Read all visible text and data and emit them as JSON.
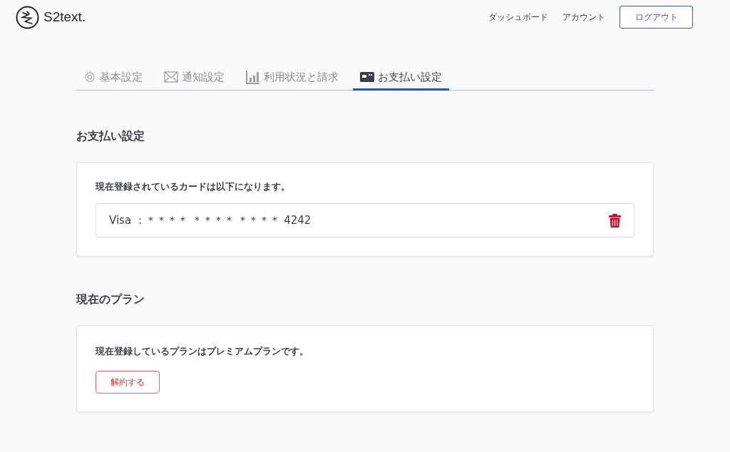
{
  "header": {
    "logo": "S2text.",
    "nav": [
      "ダッシュボード",
      "アカウント"
    ],
    "logout": "ログアウト"
  },
  "tabs": [
    {
      "kind": "gear",
      "label": "基本設定",
      "selected": false
    },
    {
      "kind": "mail",
      "label": "通知設定",
      "selected": false
    },
    {
      "kind": "chart",
      "label": "利用状況と請求",
      "selected": false
    },
    {
      "kind": "card",
      "label": "お支払い設定",
      "selected": true
    }
  ],
  "payment": {
    "heading": "お支払い設定",
    "message": "現在登録されているカードは以下になります。",
    "card": "Visa ：＊＊＊＊ ＊＊＊＊ ＊＊＊＊ 4242"
  },
  "plan": {
    "heading": "現在のプラン",
    "message": "現在登録しているプランはプレミアムプランです。",
    "cancel": "解約する"
  }
}
